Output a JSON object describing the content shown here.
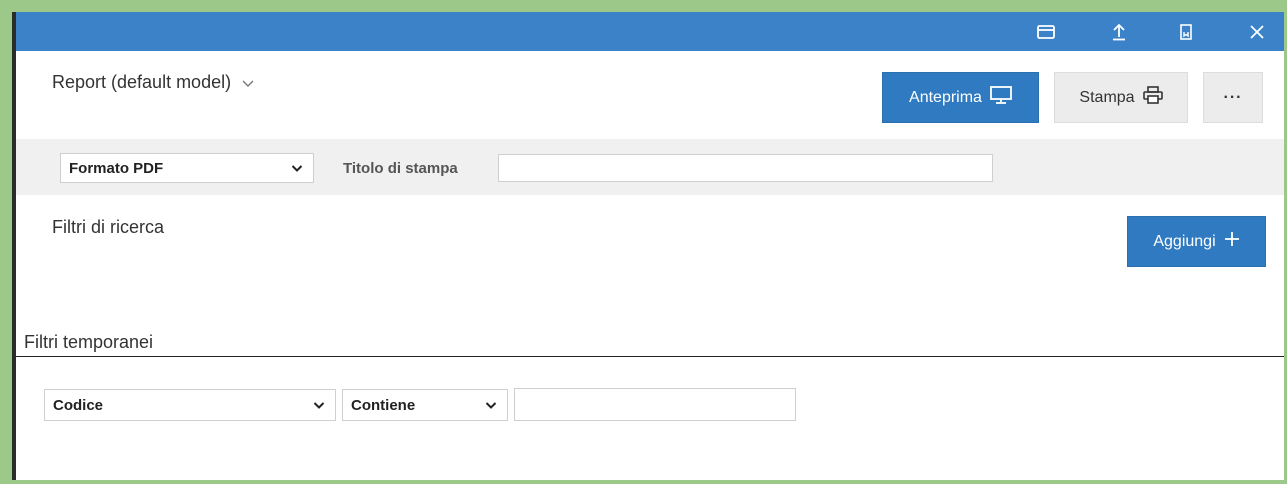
{
  "header": {
    "title": "Report (default model)",
    "buttons": {
      "preview": "Anteprima",
      "print": "Stampa",
      "more": "···"
    }
  },
  "toolbar": {
    "format_value": "Formato PDF",
    "print_title_label": "Titolo di stampa",
    "print_title_value": ""
  },
  "search_filters": {
    "title": "Filtri di ricerca",
    "add_label": "Aggiungi"
  },
  "temporary_filters": {
    "title": "Filtri temporanei",
    "field_value": "Codice",
    "operator_value": "Contiene",
    "value": ""
  },
  "colors": {
    "titlebar": "#3b82c8",
    "primary_button": "#2f7ac1",
    "frame": "#9cc98a",
    "band": "#f0f0f0"
  },
  "icons": [
    "window-icon",
    "upload-icon",
    "bookmark-icon",
    "close-icon",
    "chevron-down-icon",
    "monitor-icon",
    "printer-icon",
    "plus-icon",
    "caret-down-icon"
  ]
}
